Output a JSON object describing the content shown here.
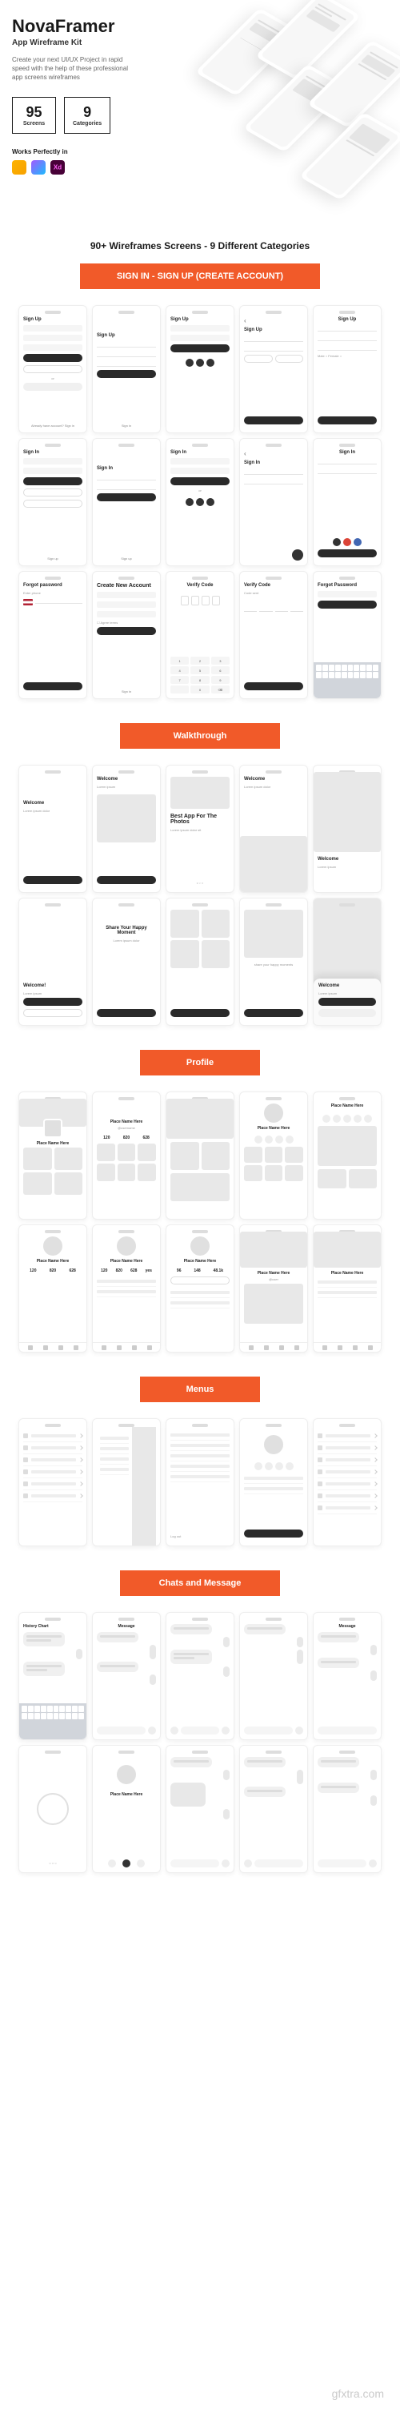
{
  "hero": {
    "brand": "NovaFramer",
    "subtitle": "App Wireframe Kit",
    "description": "Create your next UI/UX Project in rapid speed with the help of these professional app screens wireframes",
    "stat1_num": "95",
    "stat1_label": "Screens",
    "stat2_num": "9",
    "stat2_label": "Categories",
    "works_label": "Works Perfectly in"
  },
  "main_title": "90+ Wireframes Screens - 9 Different Categories",
  "sections": {
    "signin": "SIGN IN - SIGN UP (CREATE ACCOUNT)",
    "walkthrough": "Walkthrough",
    "profile": "Profile",
    "menus": "Menus",
    "chats": "Chats and Message"
  },
  "labels": {
    "signup": "Sign Up",
    "signin": "Sign In",
    "forgot": "Forgot password",
    "createnew": "Create New Account",
    "verify": "Verify Code",
    "forgotpw": "Forgot Password",
    "welcome": "Welcome",
    "welcome_ex": "Welcome!",
    "best_app": "Best App For The Photos",
    "share": "Share Your Happy Moment",
    "share_sub": "share your happy moments",
    "place_name": "Place Name Here",
    "history": "History Chart",
    "message": "Message",
    "stat1": "120",
    "stat2": "820",
    "stat3": "628",
    "stat4": "yes"
  },
  "watermark": "gfxtra.com"
}
